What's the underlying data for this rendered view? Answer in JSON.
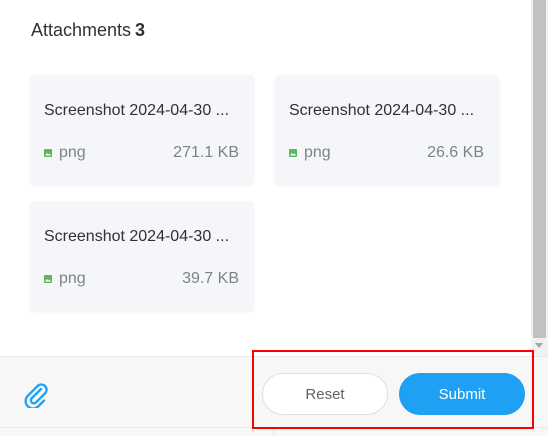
{
  "attachments": {
    "title": "Attachments",
    "count": "3",
    "files": [
      {
        "name": "Screenshot 2024-04-30 ...",
        "type": "png",
        "size": "271.1 KB"
      },
      {
        "name": "Screenshot 2024-04-30 ...",
        "type": "png",
        "size": "26.6 KB"
      },
      {
        "name": "Screenshot 2024-04-30 ...",
        "type": "png",
        "size": "39.7 KB"
      }
    ]
  },
  "footer": {
    "attach_icon": "paperclip-icon",
    "reset_label": "Reset",
    "submit_label": "Submit"
  },
  "colors": {
    "accent": "#1ea1f2",
    "file_icon": "#5cb85c",
    "highlight": "#ff0000",
    "card_bg": "#f4f6f9"
  }
}
